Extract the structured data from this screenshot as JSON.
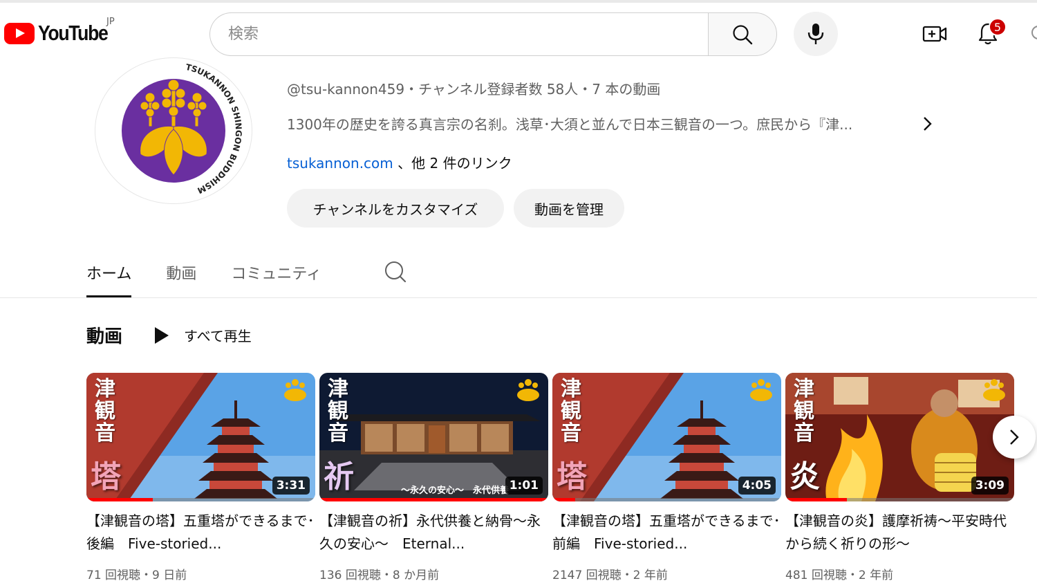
{
  "masthead": {
    "logo_text": "YouTube",
    "country_code": "JP",
    "search_placeholder": "検索",
    "notification_count": "5"
  },
  "channel": {
    "avatar_ring_text_top": "TSUKANNON SHINGON BUDDHISM",
    "handle_line": "@tsu-kannon459・チャンネル登録者数 58人・7 本の動画",
    "description": "1300年の歴史を誇る真言宗の名刹。浅草･大須と並んで日本三観音の一つ。庶民から『津...",
    "link_primary": "tsukannon.com",
    "link_more": "、他 2 件のリンク",
    "customize_label": "チャンネルをカスタマイズ",
    "manage_label": "動画を管理"
  },
  "tabs": [
    {
      "label": "ホーム",
      "active": true
    },
    {
      "label": "動画",
      "active": false
    },
    {
      "label": "コミュニティ",
      "active": false
    }
  ],
  "section": {
    "title": "動画",
    "play_all_label": "すべて再生"
  },
  "videos": [
    {
      "thumb_vertical": "津観音",
      "thumb_big": "塔",
      "big_color": "#f2a4b8",
      "duration": "3:31",
      "progress": 0.29,
      "title": "【津観音の塔】五重塔ができるまで･後編　Five-storied...",
      "meta": "71 回視聴・9 日前"
    },
    {
      "thumb_vertical": "津観音",
      "thumb_big": "祈",
      "big_color": "#e6c9f2",
      "caption": "～永久の安心～　永代供養",
      "duration": "1:01",
      "progress": 1.0,
      "title": "【津観音の祈】永代供養と納骨～永久の安心～　Eternal...",
      "meta": "136 回視聴・8 か月前"
    },
    {
      "thumb_vertical": "津観音",
      "thumb_big": "塔",
      "big_color": "#f2a4b8",
      "duration": "4:05",
      "progress": 0.1,
      "title": "【津観音の塔】五重塔ができるまで･前編　Five-storied...",
      "meta": "2147 回視聴・2 年前"
    },
    {
      "thumb_vertical": "津観音",
      "thumb_big": "炎",
      "big_color": "#ffffff",
      "duration": "3:09",
      "progress": 0.27,
      "title": "【津観音の炎】護摩祈祷～平安時代から続く祈りの形～",
      "meta": "481 回視聴・2 年前"
    }
  ]
}
